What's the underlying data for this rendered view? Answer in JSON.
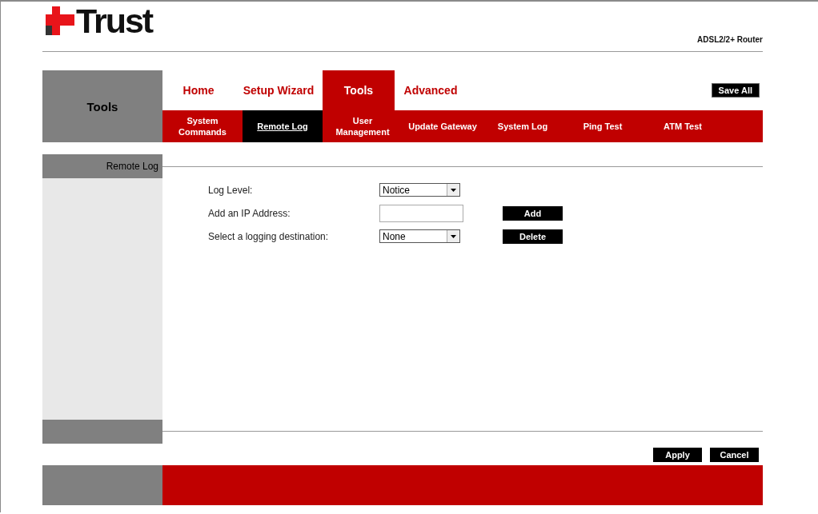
{
  "header": {
    "logo": "Trust",
    "product": "ADSL2/2+ Router"
  },
  "section_title": "Tools",
  "tabs": [
    {
      "label": "Home",
      "selected": false
    },
    {
      "label": "Setup Wizard",
      "selected": false
    },
    {
      "label": "Tools",
      "selected": true
    },
    {
      "label": "Advanced",
      "selected": false
    }
  ],
  "save_all": "Save All",
  "subtabs": [
    {
      "label": "System\nCommands",
      "selected": false
    },
    {
      "label": "Remote Log",
      "selected": true
    },
    {
      "label": "User\nManagement",
      "selected": false
    },
    {
      "label": "Update Gateway",
      "selected": false
    },
    {
      "label": "System Log",
      "selected": false
    },
    {
      "label": "Ping Test",
      "selected": false
    },
    {
      "label": "ATM Test",
      "selected": false
    }
  ],
  "sidebar": {
    "title": "Remote Log"
  },
  "form": {
    "rows": [
      {
        "kind": "select",
        "label": "Log Level:",
        "value": "Notice"
      },
      {
        "kind": "input",
        "label": "Add an IP Address:",
        "button": "Add"
      },
      {
        "kind": "select",
        "label": "Select a logging destination:",
        "value": "None",
        "button": "Delete"
      }
    ]
  },
  "buttons": [
    "Apply",
    "Cancel"
  ]
}
